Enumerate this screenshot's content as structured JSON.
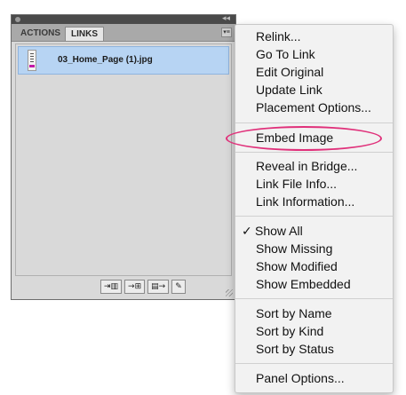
{
  "panel": {
    "tabs": [
      {
        "label": "ACTIONS"
      },
      {
        "label": "LINKS"
      }
    ],
    "links": [
      {
        "name": "03_Home_Page (1).jpg"
      }
    ],
    "footer_buttons": [
      {
        "label": "⇥▥"
      },
      {
        "label": "→⊞"
      },
      {
        "label": "▤→"
      },
      {
        "label": "✎"
      }
    ]
  },
  "menu": {
    "items": [
      {
        "label": "Relink..."
      },
      {
        "label": "Go To Link"
      },
      {
        "label": "Edit Original"
      },
      {
        "label": "Update Link"
      },
      {
        "label": "Placement Options..."
      },
      {
        "label": "Embed Image"
      },
      {
        "label": "Reveal in Bridge..."
      },
      {
        "label": "Link File Info..."
      },
      {
        "label": "Link Information..."
      },
      {
        "label": "Show All",
        "checked": true,
        "check": "✓"
      },
      {
        "label": "Show Missing"
      },
      {
        "label": "Show Modified"
      },
      {
        "label": "Show Embedded"
      },
      {
        "label": "Sort by Name"
      },
      {
        "label": "Sort by Kind"
      },
      {
        "label": "Sort by Status"
      },
      {
        "label": "Panel Options..."
      }
    ]
  },
  "annotation": {
    "highlight_color": "#e0307a"
  }
}
